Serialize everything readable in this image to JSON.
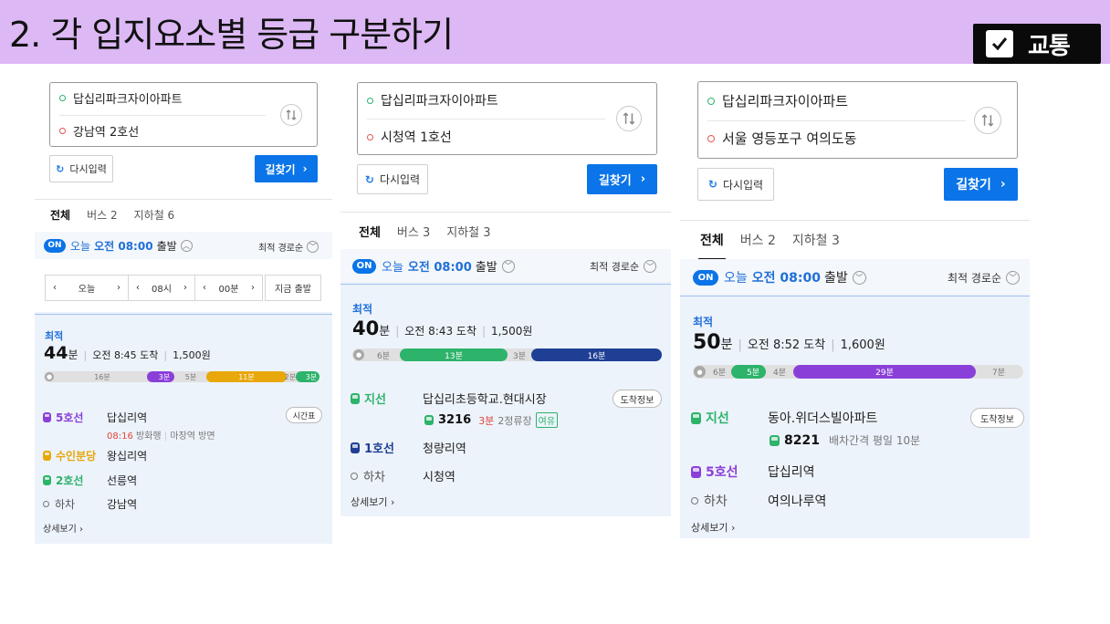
{
  "header": {
    "title": "2. 각 입지요소별 등급 구분하기",
    "tag_label": "교통",
    "colors": {
      "band": "#dcb8f4",
      "tag_bg": "#0a0a0a"
    }
  },
  "common": {
    "reset_label": "다시입력",
    "find_label": "길찾기",
    "tab_all": "전체",
    "on_badge": "ON",
    "today": "오늘",
    "depart_suffix": "출발",
    "sort_label": "최적 경로순",
    "best_label": "최적",
    "mins_unit": "분",
    "detail_more": "상세보기",
    "alight": "하차",
    "arrival_info": "도착정보"
  },
  "panels": [
    {
      "origin": "답십리파크자이아파트",
      "destination": "강남역 2호선",
      "tabs": [
        "전체",
        "버스 2",
        "지하철 6"
      ],
      "depart_time": "오전 08:00",
      "time_picker": {
        "day": "오늘",
        "hour": "08시",
        "minute": "00분",
        "now": "지금 출발"
      },
      "total_minutes": "44",
      "arrive": "오전 8:45 도착",
      "fare": "1,500원",
      "bar": {
        "walk1": "16분",
        "l5": "3분",
        "walk2": "5분",
        "bundang": "11분",
        "walk3": "2분",
        "l2": "3분"
      },
      "steps": [
        {
          "line": "5호선",
          "station": "답십리역",
          "color": "#8b3fd9"
        },
        {
          "line": "수인분당",
          "station": "왕십리역",
          "color": "#e8a70a"
        },
        {
          "line": "2호선",
          "station": "선릉역",
          "color": "#2db36a"
        },
        {
          "line": "하차",
          "station": "강남역",
          "color": "#777777"
        }
      ],
      "sub": {
        "time": "08:16",
        "dir": "방화행",
        "door": "마장역 방면"
      },
      "timetable": "시간표"
    },
    {
      "origin": "답십리파크자이아파트",
      "destination": "시청역 1호선",
      "tabs": [
        "전체",
        "버스 3",
        "지하철 3"
      ],
      "depart_time": "오전 08:00",
      "total_minutes": "40",
      "arrive": "오전 8:43 도착",
      "fare": "1,500원",
      "bar": {
        "walk1": "6분",
        "bus": "13분",
        "walk2": "3분",
        "l1": "16분"
      },
      "steps": [
        {
          "line": "지선",
          "station": "답십리초등학교.현대시장",
          "color": "#2db36a"
        },
        {
          "line": "1호선",
          "station": "청량리역",
          "color": "#1f3f95"
        },
        {
          "line": "하차",
          "station": "시청역",
          "color": "#777777"
        }
      ],
      "bus": {
        "number": "3216",
        "eta": "3분",
        "stops": "2정류장",
        "status": "여유"
      }
    },
    {
      "origin": "답십리파크자이아파트",
      "destination": "서울 영등포구 여의도동",
      "tabs": [
        "전체",
        "버스 2",
        "지하철 3"
      ],
      "depart_time": "오전 08:00",
      "total_minutes": "50",
      "arrive": "오전 8:52 도착",
      "fare": "1,600원",
      "bar": {
        "walk1": "6분",
        "bus": "5분",
        "walk2": "4분",
        "l5": "29분",
        "walk3": "7분"
      },
      "steps": [
        {
          "line": "지선",
          "station": "동아.위더스빌아파트",
          "color": "#2db36a"
        },
        {
          "line": "5호선",
          "station": "답십리역",
          "color": "#8b3fd9"
        },
        {
          "line": "하차",
          "station": "여의나루역",
          "color": "#777777"
        }
      ],
      "bus": {
        "number": "8221",
        "interval": "배차간격 평일 10분"
      }
    }
  ]
}
